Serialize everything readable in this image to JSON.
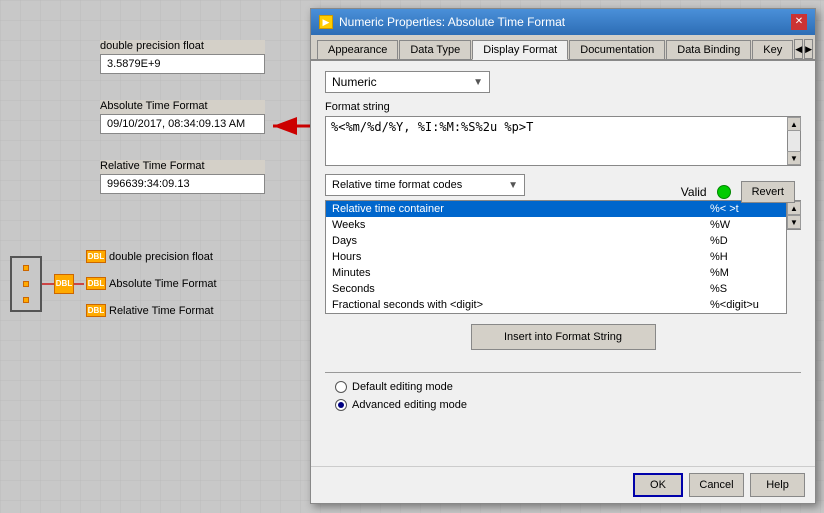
{
  "canvas": {
    "bg_color": "#c8c8c8"
  },
  "left_panel": {
    "value_blocks": [
      {
        "label": "double precision float",
        "value": "3.5879E+9"
      },
      {
        "label": "Absolute Time Format",
        "value": "09/10/2017, 08:34:09.13 AM"
      },
      {
        "label": "Relative Time Format",
        "value": "996639:34:09.13"
      }
    ],
    "diagram_items": [
      {
        "label": "double precision float",
        "tag": "DBL"
      },
      {
        "label": "Absolute Time Format",
        "tag": "DBL"
      },
      {
        "label": "Relative Time Format",
        "tag": "DBL"
      }
    ]
  },
  "dialog": {
    "title": "Numeric Properties: Absolute Time Format",
    "tabs": [
      {
        "label": "Appearance"
      },
      {
        "label": "Data Type"
      },
      {
        "label": "Display Format",
        "active": true
      },
      {
        "label": "Documentation"
      },
      {
        "label": "Data Binding"
      },
      {
        "label": "Key"
      }
    ],
    "numeric_dropdown": {
      "value": "Numeric",
      "placeholder": "Numeric"
    },
    "format_string": {
      "label": "Format string",
      "value": "%<%m/%d/%Y, %I:%M:%S%2u %p>T"
    },
    "valid": {
      "label": "Valid",
      "revert_label": "Revert"
    },
    "codes_dropdown": {
      "label": "Relative time format codes"
    },
    "table_rows": [
      {
        "col1": "Relative time container",
        "col2": "%< >t",
        "selected": true
      },
      {
        "col1": "Weeks",
        "col2": "%W",
        "selected": false
      },
      {
        "col1": "Days",
        "col2": "%D",
        "selected": false
      },
      {
        "col1": "Hours",
        "col2": "%H",
        "selected": false
      },
      {
        "col1": "Minutes",
        "col2": "%M",
        "selected": false
      },
      {
        "col1": "Seconds",
        "col2": "%S",
        "selected": false
      },
      {
        "col1": "Fractional seconds with <digit>",
        "col2": "%<digit>u",
        "selected": false
      }
    ],
    "insert_button": "Insert into Format String",
    "radio_options": [
      {
        "label": "Default editing mode",
        "checked": false
      },
      {
        "label": "Advanced editing mode",
        "checked": true
      }
    ],
    "buttons": {
      "ok": "OK",
      "cancel": "Cancel",
      "help": "Help"
    }
  }
}
